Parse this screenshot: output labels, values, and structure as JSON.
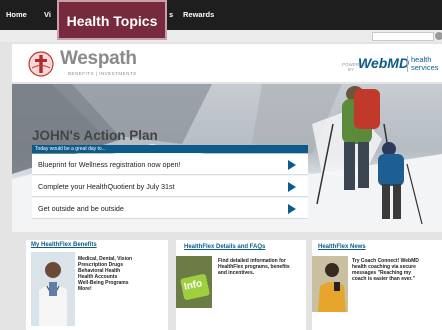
{
  "nav": {
    "items": [
      {
        "label": "Home"
      },
      {
        "label": "Vi"
      },
      {
        "label": "s"
      },
      {
        "label": "Rewards"
      }
    ],
    "highlight_label": "Health Topics"
  },
  "search": {
    "placeholder": ""
  },
  "brand": {
    "name": "Wespath",
    "tagline": "BENEFITS | INVESTMENTS",
    "powered_by": [
      "POWERED",
      "BY"
    ],
    "partner": "WebMD",
    "partner_sub": [
      "health",
      "services"
    ]
  },
  "hero": {
    "plan_title": "JOHN's Action Plan",
    "tagline": "Today would be a great day to...",
    "items": [
      {
        "label": "Blueprint for Wellness registration now open!"
      },
      {
        "label": "Complete your HealthQuotient by July 31st"
      },
      {
        "label": "Get outside and be outside"
      }
    ]
  },
  "cards": [
    {
      "title": "My HealthFlex Benefits",
      "lines": [
        "Medical, Dental, Vision",
        "Prescription Drugs",
        "Behavioral Health",
        "Health Accounts",
        "Well-Being Programs",
        "More!"
      ]
    },
    {
      "title": "HealthFlex Details and FAQs",
      "image_text": "Info",
      "lines": [
        "Find detailed information for",
        "HealthFlex programs, benefits",
        "and incentives."
      ]
    },
    {
      "title": "HealthFlex News",
      "lines": [
        "Try Coach Connect! WebMD",
        "health coaching via secure",
        "messages \"Reaching my",
        "coach is easier than ever.\""
      ]
    }
  ],
  "colors": {
    "accent": "#0b5c8a",
    "tooltip": "#762a3c",
    "nav_bg": "#1e1e1e"
  }
}
